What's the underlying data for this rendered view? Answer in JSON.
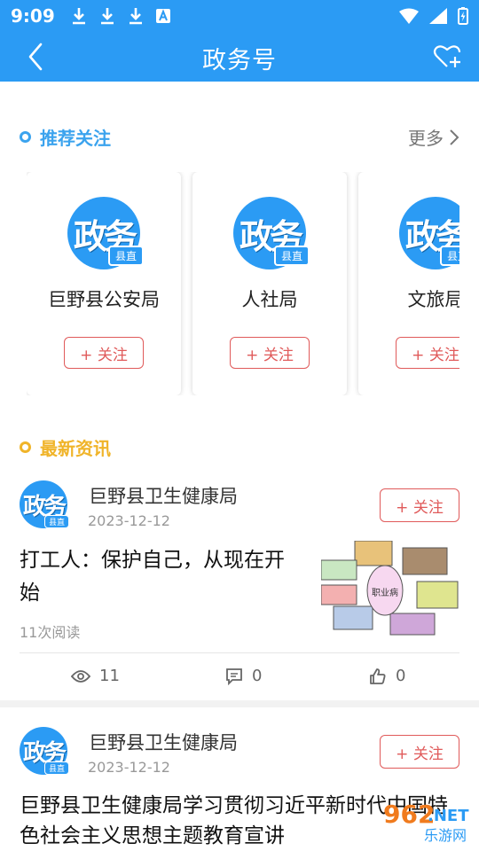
{
  "status_bar": {
    "time": "9:09"
  },
  "header": {
    "title": "政务号"
  },
  "recommend": {
    "heading": "推荐关注",
    "more_label": "更多",
    "cards": [
      {
        "name": "巨野县公安局",
        "logo_text": "政务",
        "badge": "县直",
        "follow_label": "+ 关注"
      },
      {
        "name": "人社局",
        "logo_text": "政务",
        "badge": "县直",
        "follow_label": "+ 关注"
      },
      {
        "name": "文旅局",
        "logo_text": "政务",
        "badge": "县直",
        "follow_label": "+ 关注"
      }
    ]
  },
  "news": {
    "heading": "最新资讯",
    "items": [
      {
        "source": "巨野县卫生健康局",
        "date": "2023-12-12",
        "logo_text": "政务",
        "badge": "县直",
        "follow_label": "+ 关注",
        "headline": "打工人：保护自己，从现在开始",
        "reads": "11次阅读",
        "views": "11",
        "comments": "0",
        "likes": "0",
        "thumb_center_label": "职业病"
      },
      {
        "source": "巨野县卫生健康局",
        "date": "2023-12-12",
        "logo_text": "政务",
        "badge": "县直",
        "follow_label": "+ 关注",
        "headline": "巨野县卫生健康局学习贯彻习近平新时代中国特色社会主义思想主题教育宣讲"
      }
    ]
  },
  "watermark": {
    "number": "962",
    "suffix": ".NET",
    "subtitle": "乐游网"
  },
  "colors": {
    "primary": "#2b9bf4",
    "follow": "#e05a5a",
    "recommend_accent": "#3ba3ee",
    "news_accent": "#f0b429"
  }
}
